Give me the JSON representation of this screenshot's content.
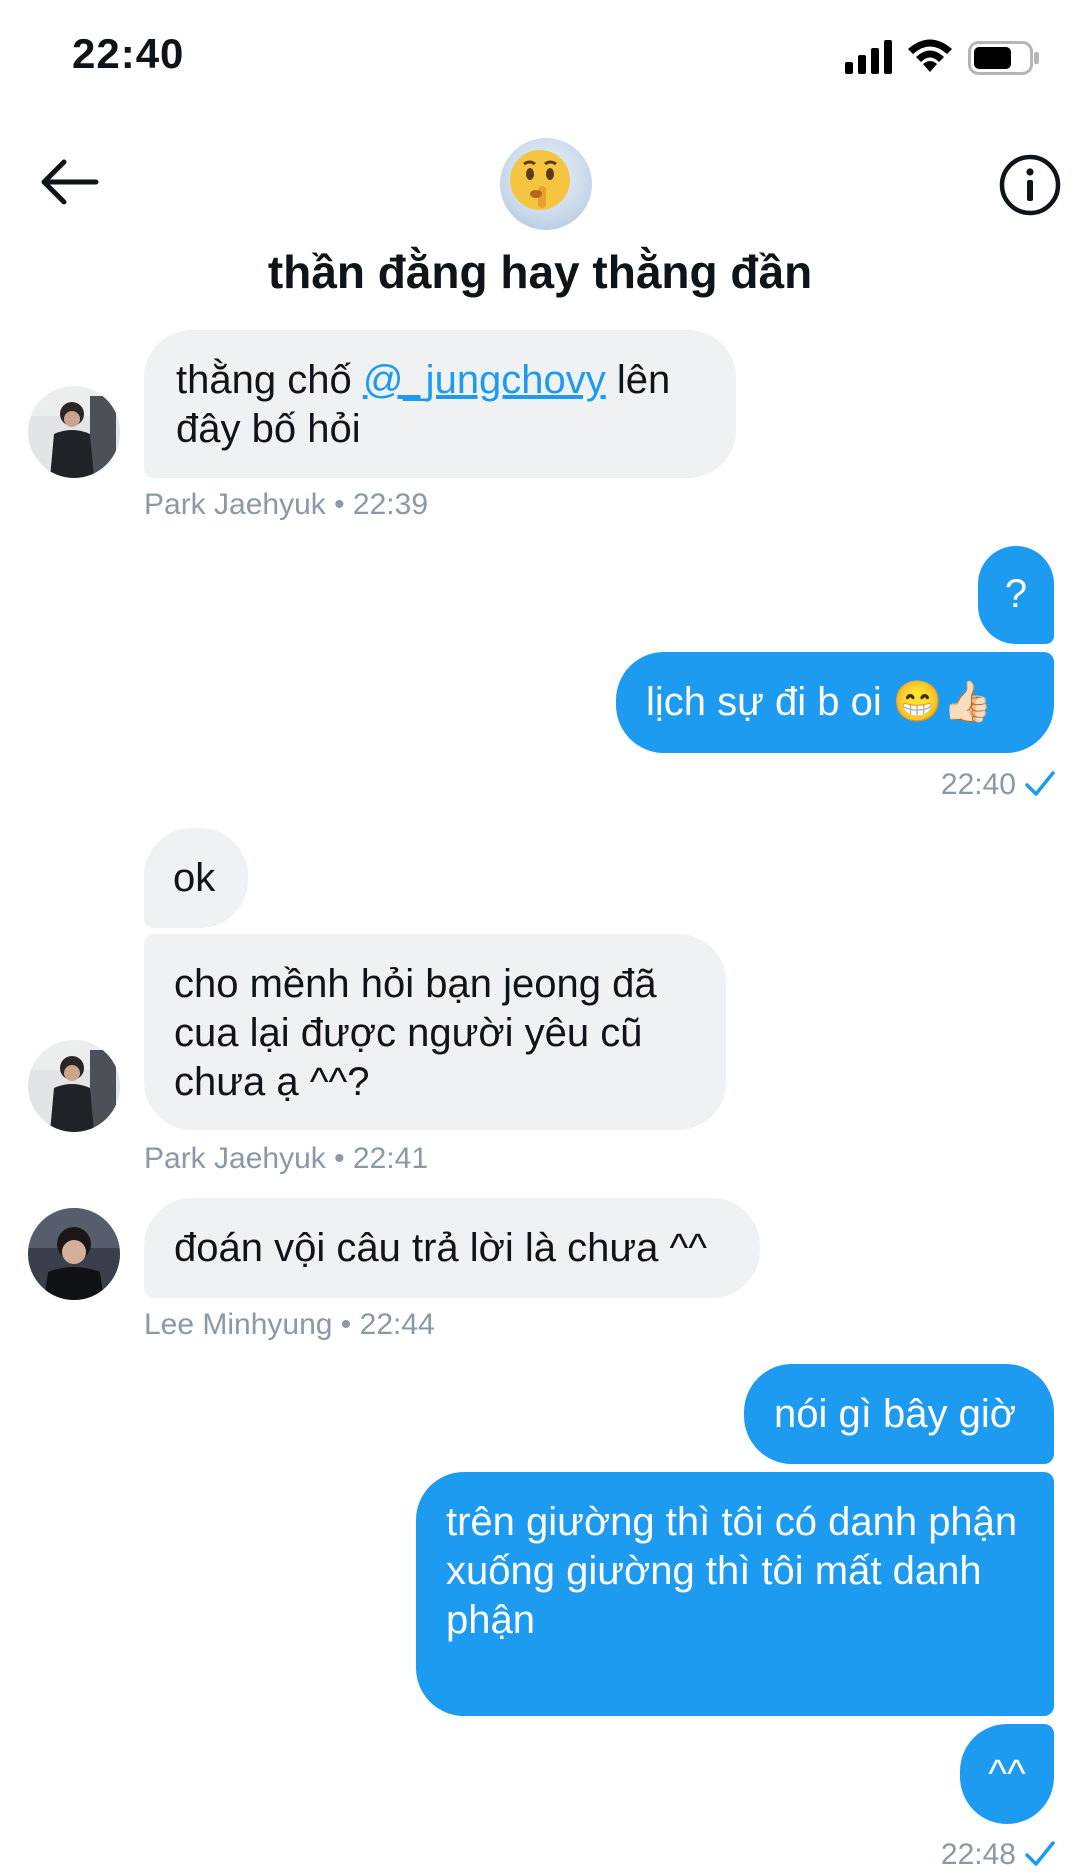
{
  "status_bar": {
    "time": "22:40"
  },
  "header": {
    "title": "thần đằng hay thằng đần"
  },
  "messages": {
    "m1": {
      "before": "thằng chố ",
      "mention": "@_jungchovy",
      "after": " lên đây bố hỏi",
      "meta": "Park Jaehyuk • 22:39"
    },
    "m2": {
      "text": "?"
    },
    "m3": {
      "text": "lịch sự đi b oi 😁👍🏻",
      "meta": "22:40"
    },
    "m4": {
      "text": "ok"
    },
    "m5": {
      "text": "cho mềnh hỏi bạn jeong đã cua lại được người yêu cũ chưa ạ ^^?",
      "meta": "Park Jaehyuk • 22:41"
    },
    "m6": {
      "text": "đoán vội câu trả lời là chưa ^^",
      "meta": "Lee Minhyung • 22:44"
    },
    "m7": {
      "text": "nói gì bây giờ"
    },
    "m8": {
      "line1": "trên giường thì tôi có danh phận",
      "line2": "xuống giường thì tôi mất danh phận"
    },
    "m9": {
      "text": "^^",
      "meta": "22:48"
    }
  },
  "colors": {
    "accent": "#1d9bf0",
    "incoming_bubble": "#eff1f3",
    "meta_text": "#8b98a5"
  }
}
